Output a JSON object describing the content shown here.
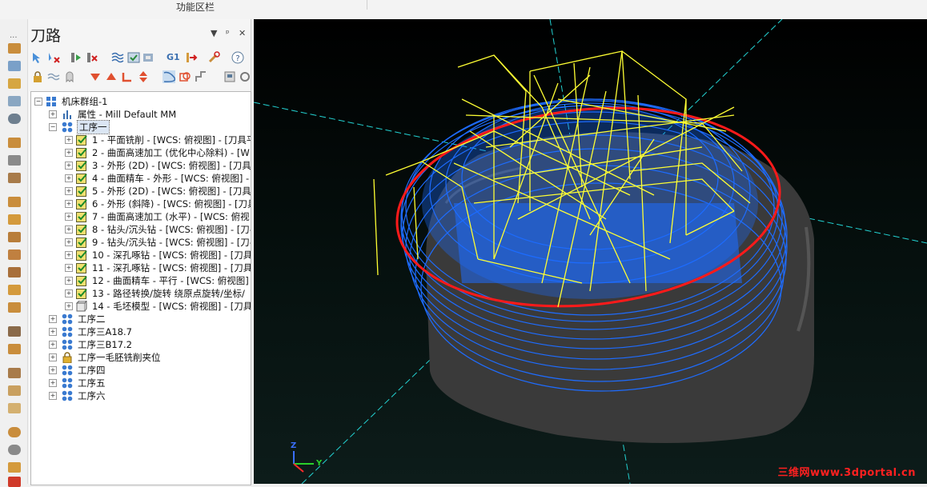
{
  "topbar": {
    "label": "功能区栏"
  },
  "panel": {
    "title": "刀路",
    "controls": {
      "menu": "▼",
      "pin": "ᵖ",
      "close": "✕"
    }
  },
  "toolbar": {
    "g1_label": "G1"
  },
  "tree": {
    "root": "机床群组-1",
    "props": "属性 - Mill Default MM",
    "group1": "工序一",
    "ops": [
      "1 - 平面铣削 - [WCS: 俯视图] - [刀具平",
      "2 - 曲面高速加工 (优化中心除料) - [W",
      "3 - 外形 (2D) - [WCS: 俯视图] - [刀具平",
      "4 - 曲面精车 - 外形 - [WCS: 俯视图] -",
      "5 - 外形 (2D) - [WCS: 俯视图] - [刀具平",
      "6 - 外形 (斜降) - [WCS: 俯视图] - [刀具",
      "7 - 曲面高速加工 (水平) - [WCS: 俯视",
      "8 - 钻头/沉头钻 - [WCS: 俯视图] - [刀-",
      "9 - 钻头/沉头钻 - [WCS: 俯视图] - [刀-",
      "10 - 深孔啄钻 - [WCS: 俯视图] - [刀具",
      "11 - 深孔啄钻 - [WCS: 俯视图] - [刀具",
      "12 - 曲面精车 - 平行 - [WCS: 俯视图]",
      "13 - 路径转换/旋转 绕原点旋转/坐标/",
      "14 - 毛坯模型 - [WCS: 俯视图] - [刀具"
    ],
    "groups": [
      "工序二",
      "工序三A18.7",
      "工序三B17.2",
      "工序一毛胚铣削夹位",
      "工序四",
      "工序五",
      "工序六"
    ]
  },
  "viewport": {
    "axis_y": "Y",
    "axis_z": "Z",
    "watermark": "三维网www.3dportal.cn"
  },
  "colors": {
    "background": "#000000",
    "toolpath_blue": "#1e6cff",
    "rapid_yellow": "#ffff33",
    "boundary_red": "#ff1a1a",
    "axis_cyan": "#23d3d3"
  }
}
